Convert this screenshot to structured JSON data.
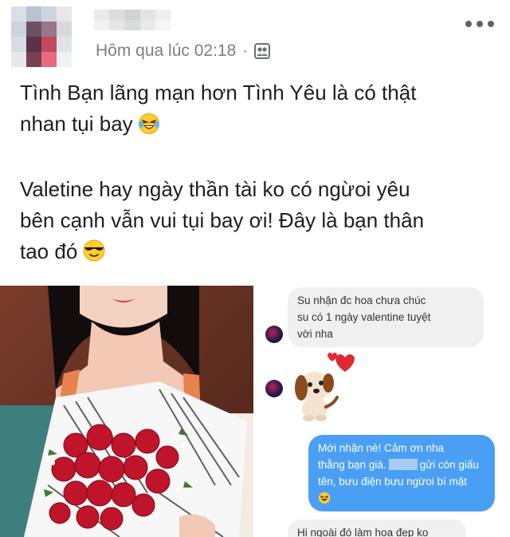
{
  "post": {
    "timestamp": "Hôm qua lúc 02:18",
    "separator": "·",
    "audience_icon": "friends-icon",
    "more_icon": "more-horizontal-icon",
    "text": {
      "line1": "Tình Bạn lãng mạn hơn Tình Yêu là có thật",
      "line2": "nhan tụi bay",
      "line3": "Valetine hay ngày thần tài ko có ngừoi yêu",
      "line4": "bên cạnh vẫn vui tụi bay ơi! Đây là bạn thân",
      "line5": "tao đó",
      "emoji1": "laughing-crying-emoji",
      "emoji2": "sunglasses-emoji"
    }
  },
  "chat": {
    "msg_in_1": [
      "Su nhận đc hoa chưa chúc",
      "su có 1 ngày valentine tuyệt",
      "vời nha"
    ],
    "sticker": "puppy-heart-sticker",
    "msg_out": [
      "Mới nhận nè! Cảm ơn nha",
      "thằng bạn già.",
      "gửi còn giấu",
      "tên, bưu điện bưu ngừoi bí mật"
    ],
    "msg_out_emoji": "laughing-crying-emoji",
    "msg_in_2": "Hi ngoài đó làm hoa đẹp ko"
  },
  "colors": {
    "text": "#1c1e21",
    "meta": "#7b7f86",
    "bubble_out": "#4a9ff5",
    "bubble_in": "#f0f0f0"
  }
}
